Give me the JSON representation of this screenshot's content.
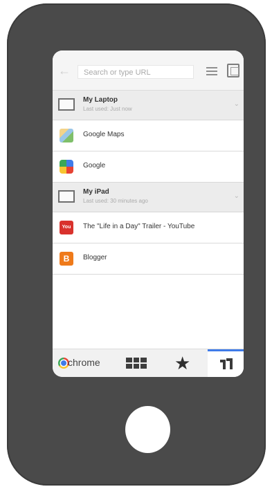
{
  "toolbar": {
    "url_placeholder": "Search or type URL"
  },
  "devices": [
    {
      "name": "My Laptop",
      "last_used": "Last used: Just now",
      "tabs": [
        {
          "title": "Google Maps",
          "icon": "google-maps-icon"
        },
        {
          "title": "Google",
          "icon": "google-icon"
        }
      ]
    },
    {
      "name": "My iPad",
      "last_used": "Last used: 30 minutes ago",
      "tabs": [
        {
          "title": "The \"Life in a Day\" Trailer - YouTube",
          "icon": "youtube-icon"
        },
        {
          "title": "Blogger",
          "icon": "blogger-icon"
        }
      ]
    }
  ],
  "bottom_bar": {
    "brand": "chrome"
  },
  "colors": {
    "phone_body": "#4a4a4a",
    "accent": "#3f7be9"
  }
}
